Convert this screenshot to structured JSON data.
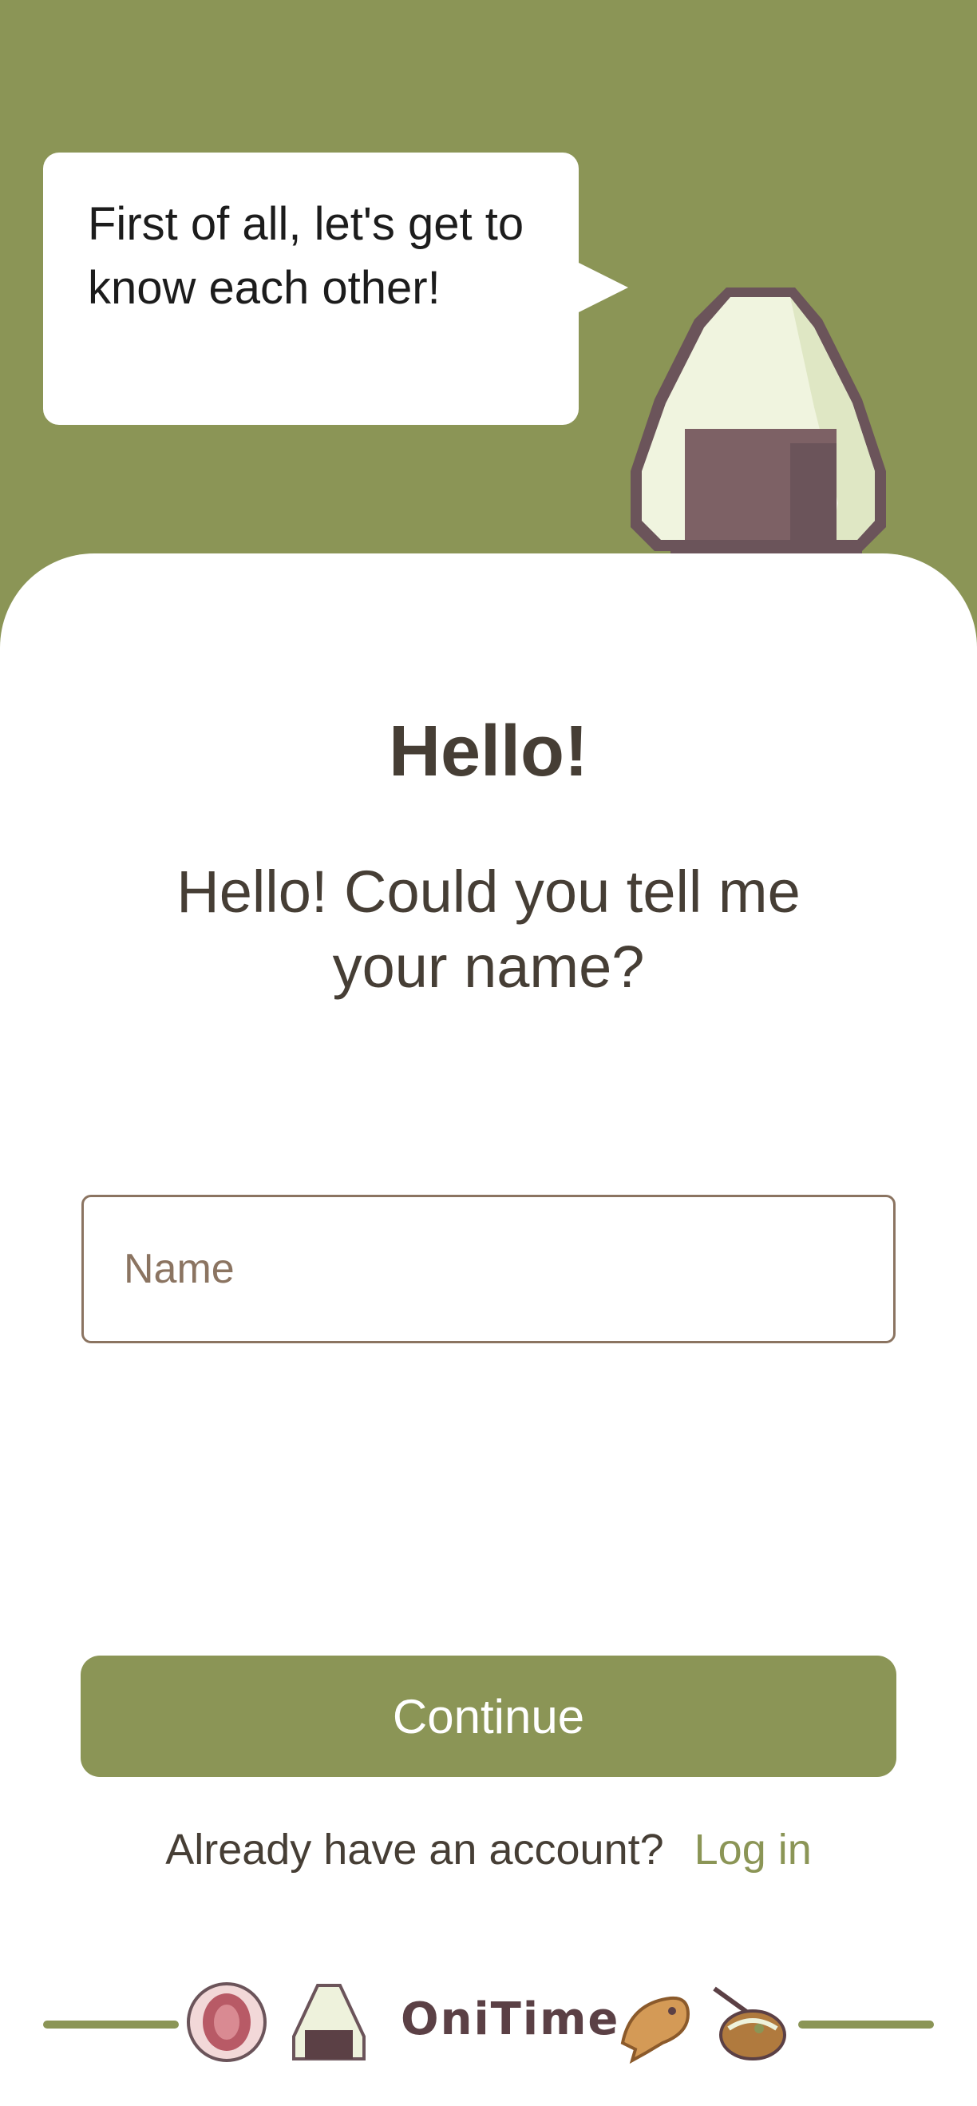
{
  "speech_bubble": {
    "text": "First of all, let's get to know each other!"
  },
  "greeting": {
    "title": "Hello!",
    "subtitle": "Hello! Could you tell me your name?"
  },
  "name_field": {
    "placeholder": "Name",
    "value": ""
  },
  "continue_button": {
    "label": "Continue"
  },
  "login": {
    "prompt": "Already have an account?",
    "link_label": "Log in"
  },
  "footer": {
    "logo_text": "OniTime",
    "icons": [
      "strawberry-daifuku-icon",
      "onigiri-icon",
      "taiyaki-icon",
      "takoyaki-icon"
    ]
  },
  "colors": {
    "primary_green": "#8b9556",
    "text_brown": "#463e35",
    "input_border": "#8b7461",
    "nori": "#7d6165"
  }
}
